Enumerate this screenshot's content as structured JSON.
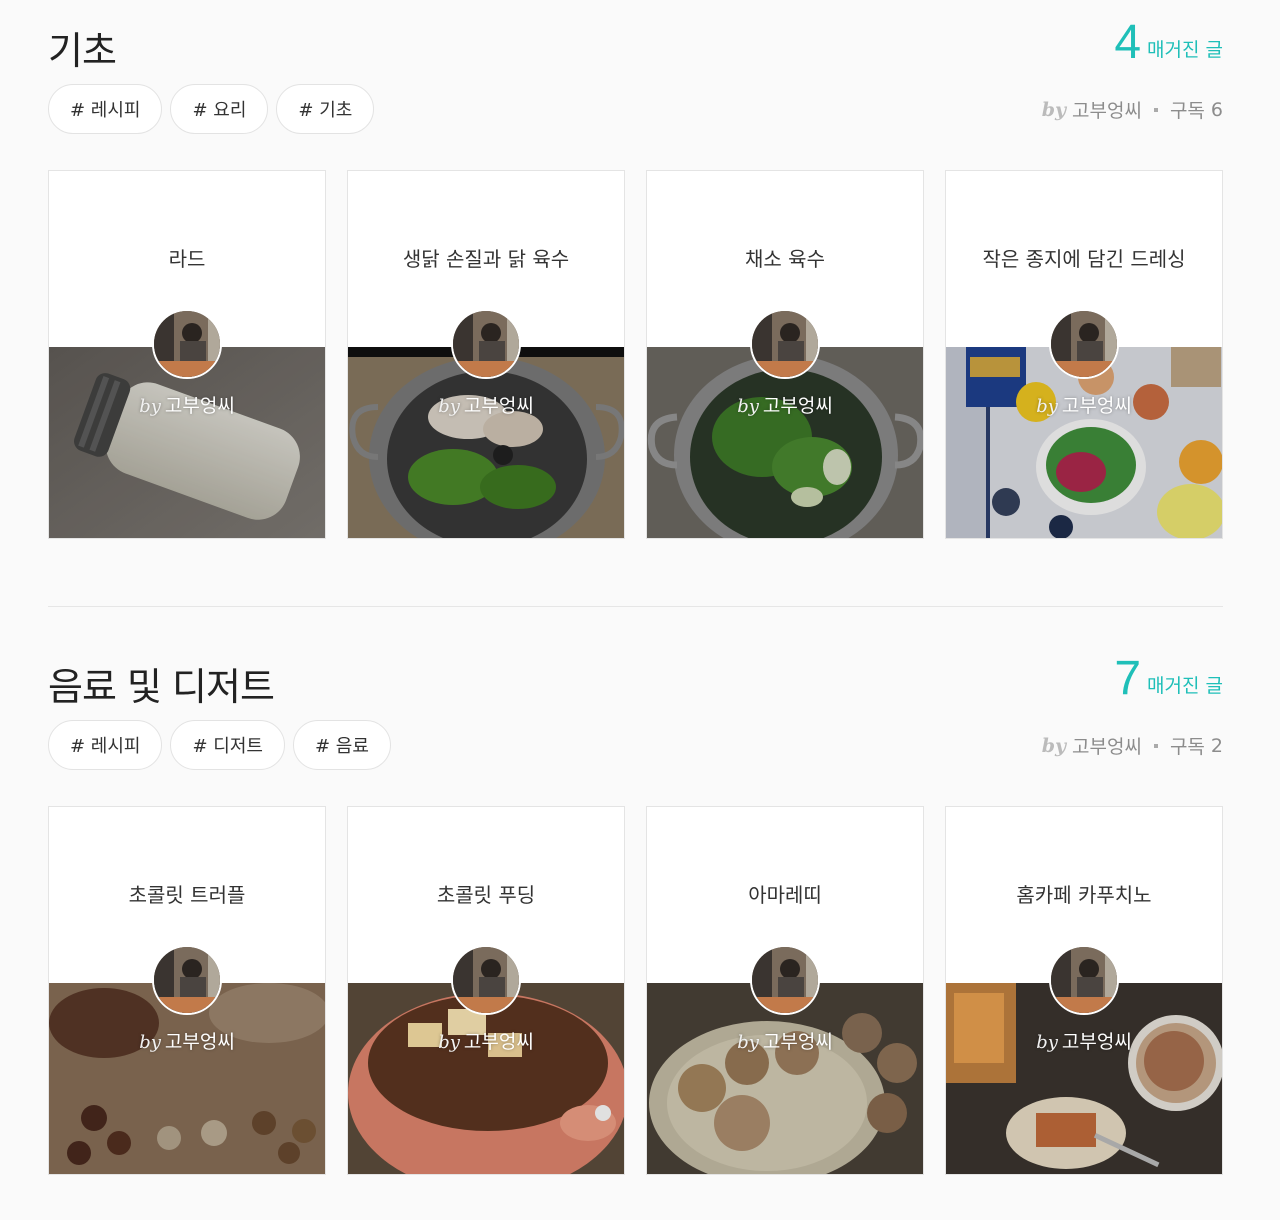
{
  "sections": [
    {
      "title": "기초",
      "count": "4",
      "count_label": "매거진 글",
      "tags": [
        "# 레시피",
        "# 요리",
        "# 기초"
      ],
      "by": "by",
      "author": "고부엉씨",
      "subscribe_label": "구독",
      "subscribe_count": "6",
      "cards": [
        {
          "title": "라드",
          "by": "by",
          "author": "고부엉씨"
        },
        {
          "title": "생닭 손질과 닭 육수",
          "by": "by",
          "author": "고부엉씨"
        },
        {
          "title": "채소 육수",
          "by": "by",
          "author": "고부엉씨"
        },
        {
          "title": "작은 종지에 담긴 드레싱",
          "by": "by",
          "author": "고부엉씨"
        }
      ]
    },
    {
      "title": "음료 및 디저트",
      "count": "7",
      "count_label": "매거진 글",
      "tags": [
        "# 레시피",
        "# 디저트",
        "# 음료"
      ],
      "by": "by",
      "author": "고부엉씨",
      "subscribe_label": "구독",
      "subscribe_count": "2",
      "cards": [
        {
          "title": "초콜릿 트러플",
          "by": "by",
          "author": "고부엉씨"
        },
        {
          "title": "초콜릿 푸딩",
          "by": "by",
          "author": "고부엉씨"
        },
        {
          "title": "아마레띠",
          "by": "by",
          "author": "고부엉씨"
        },
        {
          "title": "홈카페 카푸치노",
          "by": "by",
          "author": "고부엉씨"
        }
      ]
    }
  ],
  "colors": {
    "accent": "#1fbfb8",
    "background": "#fafafa",
    "tag_border": "#e3e3e3",
    "meta_text": "#8c8c8c"
  },
  "icons": {
    "avatar": "author-avatar-photo"
  }
}
